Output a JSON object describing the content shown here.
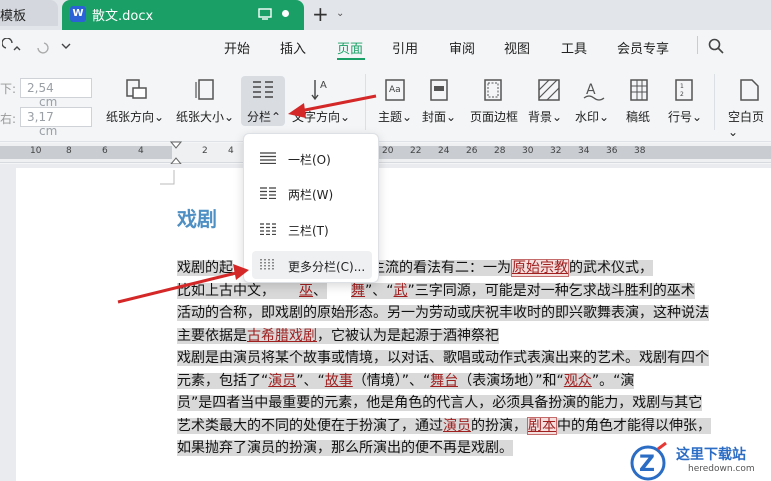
{
  "tabs": {
    "prev_tab": "模板",
    "doc_tab": "散文.docx",
    "word_logo": "W"
  },
  "menu": {
    "items": [
      "开始",
      "插入",
      "页面",
      "引用",
      "审阅",
      "视图",
      "工具",
      "会员专享"
    ],
    "active": "页面"
  },
  "ribbon": {
    "margin_top": "2,54",
    "margin_bottom": "3,17",
    "unit": "cm",
    "buttons": [
      "纸张方向",
      "纸张大小",
      "分栏",
      "文字方向",
      "主题",
      "封面",
      "页面边框",
      "背景",
      "水印",
      "稿纸",
      "行号",
      "空白页"
    ]
  },
  "ruler": [
    "10",
    "8",
    "6",
    "4",
    "2",
    "2",
    "4",
    "6",
    "8",
    "10",
    "12",
    "14",
    "16",
    "18",
    "20",
    "22",
    "24",
    "26",
    "28",
    "30",
    "32",
    "34",
    "36",
    "38"
  ],
  "dropdown": {
    "items": [
      "一栏(O)",
      "两栏(W)",
      "三栏(T)",
      "更多分栏(C)..."
    ]
  },
  "document": {
    "title": "戏剧",
    "p1l1a": "戏剧的起",
    "p1l1b": "假说。比较主流的看法有二：一为",
    "p1l1c": "原始宗教",
    "p1l1d": "的武术仪式，",
    "p1l2a": "比如上古中文，",
    "p1l2b": "巫",
    "p1l2c": "、",
    "p1l2d": "舞",
    "p1l2e": "”、“",
    "p1l2f": "武",
    "p1l2g": "”三字同源，可能是对一种乞求战斗胜利的巫术",
    "p1l3": "活动的合称，即戏剧的原始形态。另一为劳动或庆祝丰收时的即兴歌舞表演，这种说法",
    "p1l4a": "主要依据是",
    "p1l4b": "古希腊戏剧",
    "p1l4c": "，它被认为是起源于酒神祭祀",
    "p2l1": "戏剧是由演员将某个故事或情境，以对话、歌唱或动作式表演出来的艺术。戏剧有四个",
    "p2l2a": "元素，包括了“",
    "p2l2b": "演员",
    "p2l2c": "”、“",
    "p2l2d": "故事",
    "p2l2e": "（情境）”、“",
    "p2l2f": "舞台",
    "p2l2g": "（表演场地）”和“",
    "p2l2h": "观众",
    "p2l2i": "”。“演",
    "p2l3": "员”是四者当中最重要的元素，他是角色的代言人，必须具备扮演的能力，戏剧与其它",
    "p2l4a": "艺术类最大的不同的处便在于扮演了，通过",
    "p2l4b": "演员",
    "p2l4c": "的扮演，",
    "p2l4d": "剧本",
    "p2l4e": "中的角色才能得以伸张，",
    "p2l5": "如果抛弃了演员的扮演，那么所演出的便不再是戏剧。"
  },
  "watermark": {
    "name": "这里下载站",
    "url": "heredown.com"
  },
  "colors": {
    "accent": "#1a9f66",
    "title": "#4e8fc4",
    "arrow": "#d42828"
  }
}
